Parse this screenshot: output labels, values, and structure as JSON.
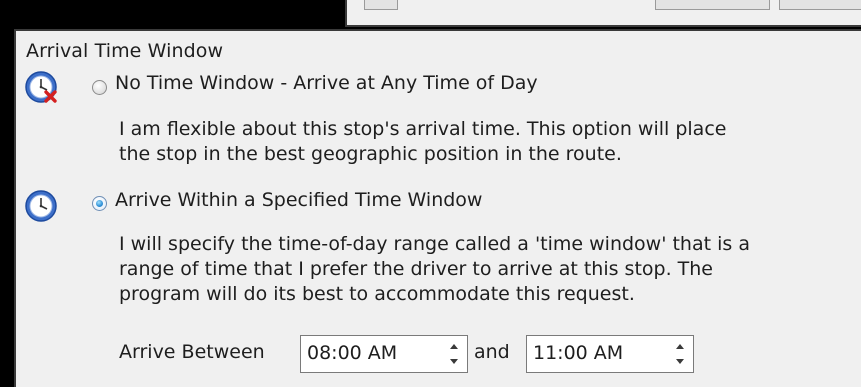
{
  "group": {
    "title": "Arrival Time Window"
  },
  "options": [
    {
      "label": "No Time Window - Arrive at Any Time of Day",
      "selected": false,
      "icon": "clock-cancel-icon",
      "description": [
        "I am flexible about this stop's arrival time.  This option will place",
        "the stop in the best geographic position in the route."
      ]
    },
    {
      "label": "Arrive Within a Specified Time Window",
      "selected": true,
      "icon": "clock-icon",
      "description": [
        "I will specify the time-of-day range called a 'time window' that is a",
        "range of time that I prefer the driver to arrive at this stop.  The",
        "program will do its best to accommodate this request."
      ]
    }
  ],
  "range": {
    "between_label": "Arrive Between",
    "start_time": "08:00 AM",
    "and_label": "and",
    "end_time": "11:00 AM"
  },
  "colors": {
    "panel_bg": "#f0f0f0",
    "accent": "#2e8fd6",
    "clock_blue": "#2b5fb8",
    "cancel_red": "#d42020"
  }
}
